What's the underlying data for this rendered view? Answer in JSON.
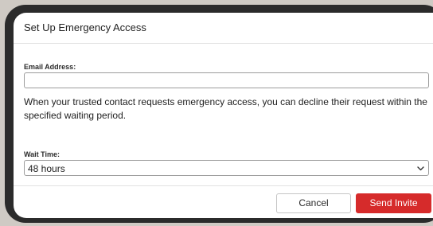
{
  "dialog": {
    "title": "Set Up Emergency Access",
    "email_field": {
      "label": "Email Address:",
      "value": "",
      "placeholder": ""
    },
    "description": "When your trusted contact requests emergency access, you can decline their request within the specified waiting period.",
    "wait_time": {
      "label": "Wait Time:",
      "selected": "48 hours",
      "icon": "chevron-down-icon"
    },
    "buttons": {
      "cancel": "Cancel",
      "send_invite": "Send Invite"
    }
  },
  "colors": {
    "primary_button": "#d62b2b",
    "page_background": "#cfcac4",
    "frame": "#2b2b2b"
  }
}
